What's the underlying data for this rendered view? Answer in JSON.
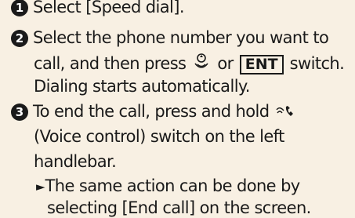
{
  "steps": [
    {
      "num": "1",
      "text": "Select [Speed dial]."
    },
    {
      "num": "2",
      "line1": "Select the phone number you want to",
      "line2a": "call, and then press",
      "or": "or",
      "ent": "ENT",
      "line2b": "switch.",
      "line3": "Dialing starts automatically."
    },
    {
      "num": "3",
      "line1": "To end the call, press and hold",
      "line2": "(Voice control) switch on the left",
      "line3": "handlebar."
    }
  ],
  "note": {
    "marker": "►",
    "line1": "The same action can be done by",
    "line2": "selecting [End call] on the screen."
  },
  "icons": {
    "press": "joystick-press-icon",
    "voice": "voice-control-icon"
  }
}
